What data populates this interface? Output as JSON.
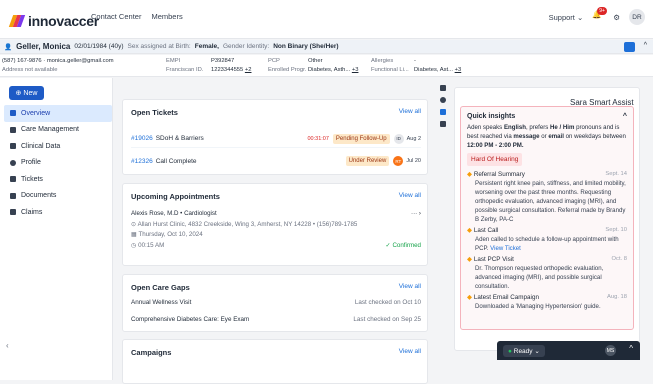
{
  "header": {
    "brand": "innovaccer",
    "nav": [
      "Contact Center",
      "Members"
    ],
    "support": "Support",
    "badge": "9+",
    "avatar": "DR"
  },
  "patient": {
    "name": "Geller, Monica",
    "dob": "02/01/1984 (40y)",
    "sex_label": "Sex assigned at Birth:",
    "sex": "Female,",
    "gender_label": "Gender Identity:",
    "gender": "Non Binary (She/Her)"
  },
  "info": {
    "phone": "(587) 167-9876",
    "email": "monica.geller@gmail.com",
    "address": "Address not available",
    "empi_label": "EMPI",
    "empi": "P392847",
    "fran_label": "Franciscan ID.",
    "fran": "1223344555",
    "fran_more": "+2",
    "pcp_label": "PCP",
    "pcp": "Other",
    "enrolled_label": "Enrolled Progr.",
    "enrolled": "Diabetes, Asth...",
    "enrolled_more": "+3",
    "allergies_label": "Allergies",
    "allergies": "-",
    "functional_label": "Functional Li...",
    "functional": "Diabetes, Ast...",
    "functional_more": "+3"
  },
  "sidebar": {
    "new_label": "New",
    "items": [
      "Overview",
      "Care Management",
      "Clinical Data",
      "Profile",
      "Tickets",
      "Documents",
      "Claims"
    ]
  },
  "tickets": {
    "title": "Open Tickets",
    "view_all": "View all",
    "rows": [
      {
        "id": "#19026",
        "title": "SDoH & Barriers",
        "time": "00:31:07",
        "status": "Pending Follow-Up",
        "initials": "ID",
        "date": "Aug 2"
      },
      {
        "id": "#12326",
        "title": "Call Complete",
        "time": "",
        "status": "Under Review",
        "initials": "RT",
        "date": "Jul 20"
      }
    ]
  },
  "appointments": {
    "title": "Upcoming Appointments",
    "view_all": "View all",
    "doctor": "Alexis Rose, M.D",
    "specialty": "Cardiologist",
    "address": "Allan Hurst Clinic, 4832 Creekside, Wing 3, Amherst, NY 14228",
    "phone": "(156)789-1785",
    "date": "Thursday, Oct 10, 2024",
    "time": "00:15 AM",
    "status": "Confirmed"
  },
  "care_gaps": {
    "title": "Open Care Gaps",
    "view_all": "View all",
    "rows": [
      {
        "name": "Annual Wellness Visit",
        "checked": "Last checked on Oct 10"
      },
      {
        "name": "Comprehensive Diabetes Care: Eye Exam",
        "checked": "Last checked on Sep 25"
      }
    ]
  },
  "campaigns": {
    "title": "Campaigns",
    "view_all": "View all"
  },
  "assist": {
    "title": "Sara Smart Assist",
    "qi_title": "Quick insights",
    "intro_a": "Aden speaks ",
    "lang": "English",
    "intro_b": ", prefers ",
    "pron": "He / Him",
    "intro_c": " pronouns and is best reached via ",
    "channel": "message",
    "intro_d": " or ",
    "channel2": "email",
    "intro_e": " on weekdays between ",
    "hours": "12:00 PM - 2:00 PM.",
    "tag": "Hard Of Hearing",
    "sections": [
      {
        "title": "Referral Summary",
        "date": "Sept. 14",
        "text": "Persistent right knee pain, stiffness, and limited mobility, worsening over the past three months. Requesting orthopedic evaluation, advanced imaging (MRI), and possible surgical consultation. Referral made by Brandy B Zerby, PA-C"
      },
      {
        "title": "Last Call",
        "date": "Sept. 10",
        "text": "Aden called to schedule a follow-up appointment with PCP.",
        "link": "View Ticket"
      },
      {
        "title": "Last PCP Visit",
        "date": "Oct. 8",
        "text": "Dr. Thompson requested orthopedic evaluation, advanced imaging (MRI), and possible surgical consultation."
      },
      {
        "title": "Latest Email Campaign",
        "date": "Aug. 18",
        "text": "Downloaded a 'Managing Hypertension' guide."
      }
    ]
  },
  "status": {
    "ready": "Ready",
    "user": "MS"
  }
}
